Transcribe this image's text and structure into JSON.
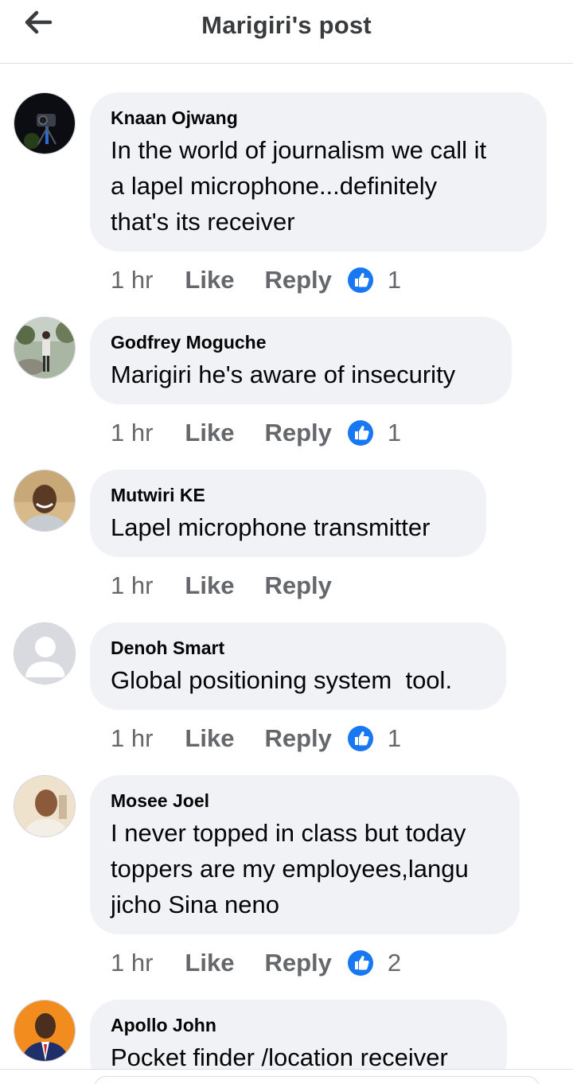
{
  "header": {
    "title": "Marigiri's post",
    "back_icon": "arrow-left-icon"
  },
  "ghost_row": {
    "like": "Like",
    "reply": "Reply"
  },
  "comments": [
    {
      "name": "Knaan Ojwang",
      "text": "In the world of journalism we call it\na lapel microphone...definitely\nthat's its receiver",
      "time": "1 hr",
      "like": "Like",
      "reply": "Reply",
      "reactions": "1"
    },
    {
      "name": "Godfrey Moguche",
      "text": "Marigiri he's aware of insecurity",
      "time": "1 hr",
      "like": "Like",
      "reply": "Reply",
      "reactions": "1"
    },
    {
      "name": "Mutwiri KE",
      "text": "Lapel microphone transmitter",
      "time": "1 hr",
      "like": "Like",
      "reply": "Reply",
      "reactions": ""
    },
    {
      "name": "Denoh Smart",
      "text": "Global positioning system  tool.",
      "time": "1 hr",
      "like": "Like",
      "reply": "Reply",
      "reactions": "1"
    },
    {
      "name": "Mosee Joel",
      "text": "I never topped in class but today\ntoppers are my employees,langu\njicho Sina neno",
      "time": "1 hr",
      "like": "Like",
      "reply": "Reply",
      "reactions": "2"
    },
    {
      "name": "Apollo John",
      "text": "Pocket finder /location receiver",
      "time": "",
      "like": "",
      "reply": "",
      "reactions": ""
    }
  ],
  "colors": {
    "bubble": "#f0f2f5",
    "meta": "#65676b",
    "like_blue": "#1877f2"
  }
}
